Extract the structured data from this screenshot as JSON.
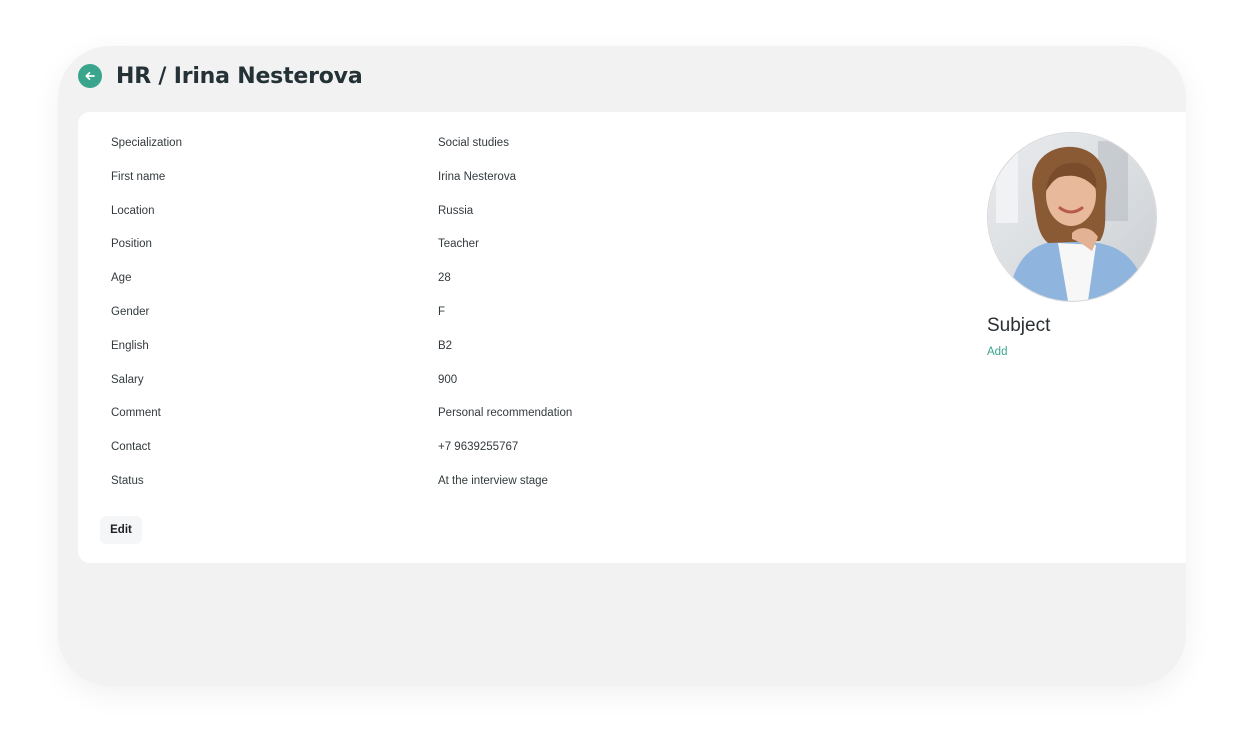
{
  "header": {
    "title": "HR / Irina Nesterova",
    "back_icon": "arrow-left-circle-icon"
  },
  "profile": {
    "rows": [
      {
        "label": "Specialization",
        "value": "Social studies"
      },
      {
        "label": "First name",
        "value": "Irina Nesterova"
      },
      {
        "label": "Location",
        "value": "Russia"
      },
      {
        "label": "Position",
        "value": "Teacher"
      },
      {
        "label": "Age",
        "value": "28"
      },
      {
        "label": "Gender",
        "value": "F"
      },
      {
        "label": "English",
        "value": "B2"
      },
      {
        "label": "Salary",
        "value": "900"
      },
      {
        "label": "Comment",
        "value": "Personal recommendation"
      },
      {
        "label": "Contact",
        "value": "+7 9639255767"
      },
      {
        "label": "Status",
        "value": "At the interview stage"
      }
    ],
    "edit_label": "Edit"
  },
  "side": {
    "subject_title": "Subject",
    "add_label": "Add"
  },
  "colors": {
    "accent": "#3aa58d",
    "frame_bg": "#f2f2f2",
    "card_bg": "#ffffff"
  }
}
